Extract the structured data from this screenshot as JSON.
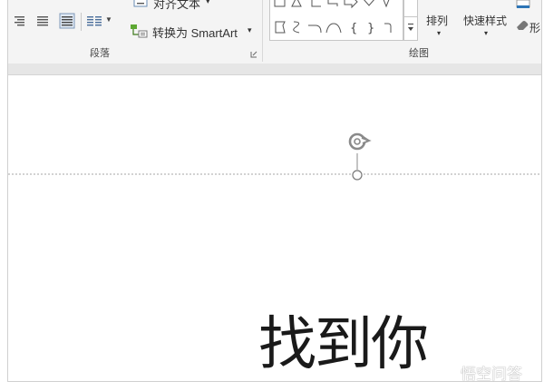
{
  "ribbon": {
    "paragraph": {
      "align_text_label": "对齐文本",
      "align_text_arrow": "▾",
      "convert_smartart_label": "转换为 SmartArt",
      "convert_smartart_arrow": "▾",
      "group_label": "段落"
    },
    "drawing": {
      "arrange_label": "排列",
      "quick_styles_label": "快速样式",
      "shape_fill_label": "形",
      "group_label": "绘图"
    }
  },
  "slide": {
    "textbox_text": "找到你"
  },
  "watermark": {
    "text": "悟空问答"
  }
}
